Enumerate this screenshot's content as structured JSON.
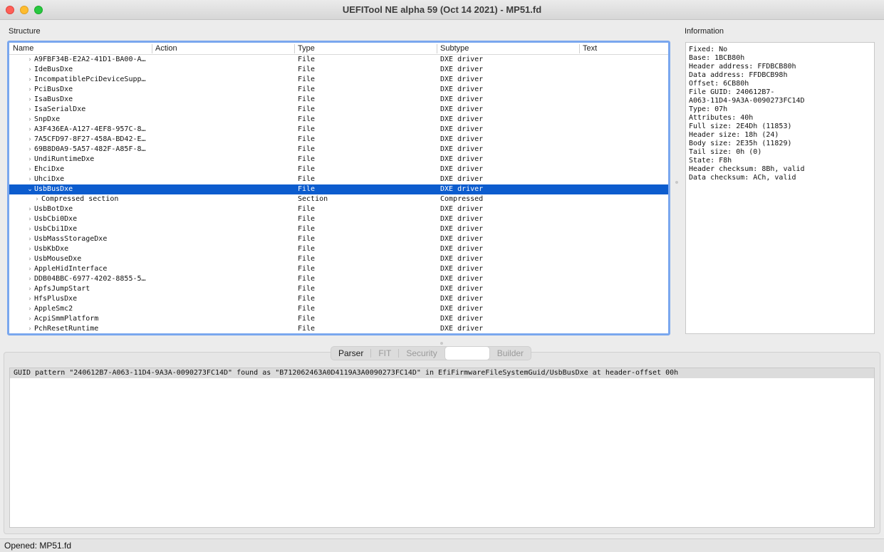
{
  "window": {
    "title": "UEFITool NE alpha 59 (Oct 14 2021) - MP51.fd"
  },
  "structure": {
    "label": "Structure",
    "columns": [
      "Name",
      "Action",
      "Type",
      "Subtype",
      "Text"
    ],
    "rows": [
      {
        "name": "A9FBF34B-E2A2-41D1-BA00-A…",
        "type": "File",
        "subtype": "DXE driver"
      },
      {
        "name": "IdeBusDxe",
        "type": "File",
        "subtype": "DXE driver"
      },
      {
        "name": "IncompatiblePciDeviceSupp…",
        "type": "File",
        "subtype": "DXE driver"
      },
      {
        "name": "PciBusDxe",
        "type": "File",
        "subtype": "DXE driver"
      },
      {
        "name": "IsaBusDxe",
        "type": "File",
        "subtype": "DXE driver"
      },
      {
        "name": "IsaSerialDxe",
        "type": "File",
        "subtype": "DXE driver"
      },
      {
        "name": "SnpDxe",
        "type": "File",
        "subtype": "DXE driver"
      },
      {
        "name": "A3F436EA-A127-4EF8-957C-8…",
        "type": "File",
        "subtype": "DXE driver"
      },
      {
        "name": "7A5CFD97-8F27-458A-BD42-E…",
        "type": "File",
        "subtype": "DXE driver"
      },
      {
        "name": "69B8D0A9-5A57-482F-A85F-8…",
        "type": "File",
        "subtype": "DXE driver"
      },
      {
        "name": "UndiRuntimeDxe",
        "type": "File",
        "subtype": "DXE driver"
      },
      {
        "name": "EhciDxe",
        "type": "File",
        "subtype": "DXE driver"
      },
      {
        "name": "UhciDxe",
        "type": "File",
        "subtype": "DXE driver"
      },
      {
        "name": "UsbBusDxe",
        "type": "File",
        "subtype": "DXE driver"
      },
      {
        "name": "Compressed section",
        "type": "Section",
        "subtype": "Compressed"
      },
      {
        "name": "UsbBotDxe",
        "type": "File",
        "subtype": "DXE driver"
      },
      {
        "name": "UsbCbi0Dxe",
        "type": "File",
        "subtype": "DXE driver"
      },
      {
        "name": "UsbCbi1Dxe",
        "type": "File",
        "subtype": "DXE driver"
      },
      {
        "name": "UsbMassStorageDxe",
        "type": "File",
        "subtype": "DXE driver"
      },
      {
        "name": "UsbKbDxe",
        "type": "File",
        "subtype": "DXE driver"
      },
      {
        "name": "UsbMouseDxe",
        "type": "File",
        "subtype": "DXE driver"
      },
      {
        "name": "AppleHidInterface",
        "type": "File",
        "subtype": "DXE driver"
      },
      {
        "name": "DDB04BBC-6977-4202-8855-5…",
        "type": "File",
        "subtype": "DXE driver"
      },
      {
        "name": "ApfsJumpStart",
        "type": "File",
        "subtype": "DXE driver"
      },
      {
        "name": "HfsPlusDxe",
        "type": "File",
        "subtype": "DXE driver"
      },
      {
        "name": "AppleSmc2",
        "type": "File",
        "subtype": "DXE driver"
      },
      {
        "name": "AcpiSmmPlatform",
        "type": "File",
        "subtype": "DXE driver"
      },
      {
        "name": "PchResetRuntime",
        "type": "File",
        "subtype": "DXE driver"
      }
    ]
  },
  "information": {
    "label": "Information",
    "lines": [
      "Fixed: No",
      "Base: 1BCB80h",
      "Header address: FFDBCB80h",
      "Data address: FFDBCB98h",
      "Offset: 6CB80h",
      "File GUID: 240612B7-",
      "A063-11D4-9A3A-0090273FC14D",
      "Type: 07h",
      "Attributes: 40h",
      "Full size: 2E4Dh (11853)",
      "Header size: 18h (24)",
      "Body size: 2E35h (11829)",
      "Tail size: 0h (0)",
      "State: F8h",
      "Header checksum: 8Bh, valid",
      "Data checksum: ACh, valid"
    ]
  },
  "tabs": [
    "Parser",
    "FIT",
    "Security",
    "",
    "Builder"
  ],
  "log": {
    "message": "GUID pattern \"240612B7-A063-11D4-9A3A-0090273FC14D\" found as \"B712062463A0D4119A3A0090273FC14D\" in EfiFirmwareFileSystemGuid/UsbBusDxe at header-offset 00h"
  },
  "status": {
    "text": "Opened: MP51.fd"
  },
  "colors": {
    "selection": "#0c5cce",
    "focus_ring": "#7aa7ee"
  }
}
